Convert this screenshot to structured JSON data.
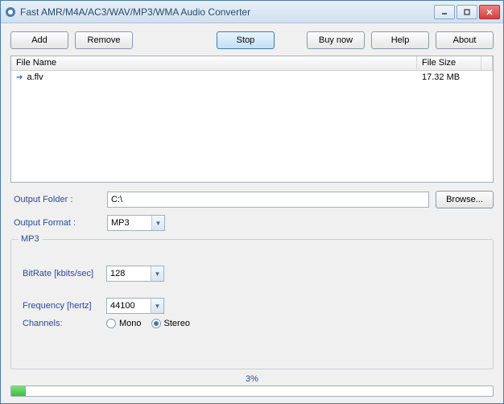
{
  "title": "Fast AMR/M4A/AC3/WAV/MP3/WMA Audio Converter",
  "toolbar": {
    "add": "Add",
    "remove": "Remove",
    "stop": "Stop",
    "buynow": "Buy now",
    "help": "Help",
    "about": "About"
  },
  "list": {
    "col_name": "File Name",
    "col_size": "File Size",
    "rows": [
      {
        "name": "a.flv",
        "size": "17.32 MB"
      }
    ]
  },
  "output_folder_label": "Output Folder :",
  "output_folder_value": "C:\\",
  "browse_label": "Browse...",
  "output_format_label": "Output Format :",
  "output_format_value": "MP3",
  "format_group": {
    "legend": "MP3",
    "bitrate_label": "BitRate [kbits/sec]",
    "bitrate_value": "128",
    "frequency_label": "Frequency [hertz]",
    "frequency_value": "44100",
    "channels_label": "Channels:",
    "mono_label": "Mono",
    "stereo_label": "Stereo",
    "channels_selected": "stereo"
  },
  "progress": {
    "text": "3%",
    "percent": 3
  }
}
